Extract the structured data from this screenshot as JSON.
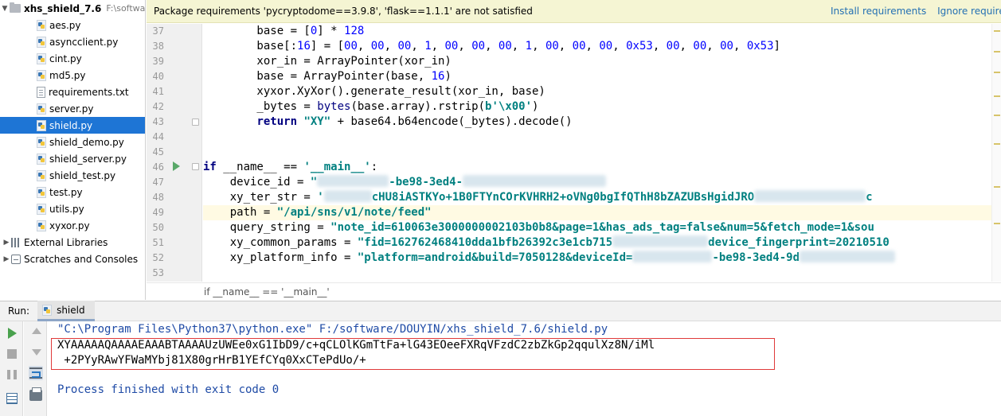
{
  "project": {
    "root": {
      "name": "xhs_shield_7.6",
      "path": "F:\\softwa"
    },
    "files": [
      {
        "name": "aes.py",
        "kind": "py"
      },
      {
        "name": "asyncclient.py",
        "kind": "py"
      },
      {
        "name": "cint.py",
        "kind": "py"
      },
      {
        "name": "md5.py",
        "kind": "py"
      },
      {
        "name": "requirements.txt",
        "kind": "txt"
      },
      {
        "name": "server.py",
        "kind": "py"
      },
      {
        "name": "shield.py",
        "kind": "py",
        "selected": true
      },
      {
        "name": "shield_demo.py",
        "kind": "py"
      },
      {
        "name": "shield_server.py",
        "kind": "py"
      },
      {
        "name": "shield_test.py",
        "kind": "py"
      },
      {
        "name": "test.py",
        "kind": "py"
      },
      {
        "name": "utils.py",
        "kind": "py"
      },
      {
        "name": "xyxor.py",
        "kind": "py"
      }
    ],
    "external_libraries": "External Libraries",
    "scratches": "Scratches and Consoles"
  },
  "notification": {
    "message": "Package requirements 'pycryptodome==3.9.8', 'flask==1.1.1' are not satisfied",
    "install_link": "Install requirements",
    "ignore_link": "Ignore requiren"
  },
  "editor": {
    "line_numbers": [
      "37",
      "38",
      "39",
      "40",
      "41",
      "42",
      "43",
      "44",
      "45",
      "46",
      "47",
      "48",
      "49",
      "50",
      "51",
      "52",
      "53"
    ],
    "current_line": "49",
    "code": {
      "l37_a": "        base = [",
      "l37_b": "0",
      "l37_c": "] * ",
      "l37_d": "128",
      "l38_a": "        base[:",
      "l38_b": "16",
      "l38_c": "] = [",
      "l38_d": "00",
      "l38_e": ", ",
      "l38_f": "00",
      "l38_g": ", ",
      "l38_h": "00",
      "l38_i": ", ",
      "l38_j": "1",
      "l38_k": ", ",
      "l38_l": "00",
      "l38_m": ", ",
      "l38_n": "00",
      "l38_o": ", ",
      "l38_p": "00",
      "l38_q": ", ",
      "l38_r": "1",
      "l38_s": ", ",
      "l38_t": "00",
      "l38_u": ", ",
      "l38_v": "00",
      "l38_w": ", ",
      "l38_x": "00",
      "l38_y": ", ",
      "l38_z": "0x53",
      "l38_z2": ", ",
      "l38_z3": "00",
      "l38_z4": ", ",
      "l38_z5": "00",
      "l38_z6": ", ",
      "l38_z7": "00",
      "l38_z8": ", ",
      "l38_z9": "0x53",
      "l38_end": "]",
      "l39": "        xor_in = ArrayPointer(xor_in)",
      "l40_a": "        base = ArrayPointer(base, ",
      "l40_b": "16",
      "l40_c": ")",
      "l41": "        xyxor.XyXor().generate_result(xor_in, base)",
      "l42_a": "        _bytes = ",
      "l42_b": "bytes",
      "l42_c": "(base.array).rstrip(",
      "l42_d": "b'\\x00'",
      "l42_e": ")",
      "l43_kw": "return",
      "l43_str": "\"XY\"",
      "l43_rest": " + base64.b64encode(_bytes).decode()",
      "l46_kw": "if",
      "l46_mid": " __name__ == ",
      "l46_str": "'__main__'",
      "l46_end": ":",
      "l47_a": "    device_id = ",
      "l47_b": "\"",
      "l47_c": "-be98-3ed4-",
      "l48_a": "    xy_ter_str = ",
      "l48_b": "'",
      "l48_c": "cHU8iASTKYo+1B0FTYnCOrKVHRH2+oVNg0bgIfQThH8bZAZUBsHgidJRO",
      "l48_d": "c",
      "l49_a": "    path = ",
      "l49_b": "\"/api/sns/v1/note/feed\"",
      "l50_a": "    query_string = ",
      "l50_b": "\"note_id=610063e3000000002103b0b8&page=1&has_ads_tag=false&num=5&fetch_mode=1&sou",
      "l51_a": "    xy_common_params = ",
      "l51_b": "\"fid=162762468410dda1bfb26392c3e1cb715",
      "l51_c": "device_fingerprint=20210510",
      "l52_a": "    xy_platform_info = ",
      "l52_b": "\"platform=android&build=7050128&deviceId=",
      "l52_c": "-be98-3ed4-9d"
    },
    "breadcrumb": "if __name__ == '__main__'"
  },
  "run": {
    "label": "Run:",
    "tab": "shield",
    "command": "\"C:\\Program Files\\Python37\\python.exe\" F:/software/DOUYIN/xhs_shield_7.6/shield.py",
    "output_line1": "XYAAAAAQAAAAEAAABTAAAAUzUWEe0xG1IbD9/c+qCLOlKGmTtFa+lG43EOeeFXRqVFzdC2zbZkGp2qqulXz8N/iMl",
    "output_line2": " +2PYyRAwYFWaMYbj81X80grHrB1YEfCYq0XxCTePdUo/+",
    "exit": "Process finished with exit code 0"
  },
  "colors": {
    "selection": "#1e75d5",
    "notification_bg": "#f5f5d3",
    "keyword": "#000080",
    "string": "#008080",
    "number": "#0000ff",
    "console_cmd": "#1f4ba6",
    "highlight_box": "#e03a3a"
  }
}
